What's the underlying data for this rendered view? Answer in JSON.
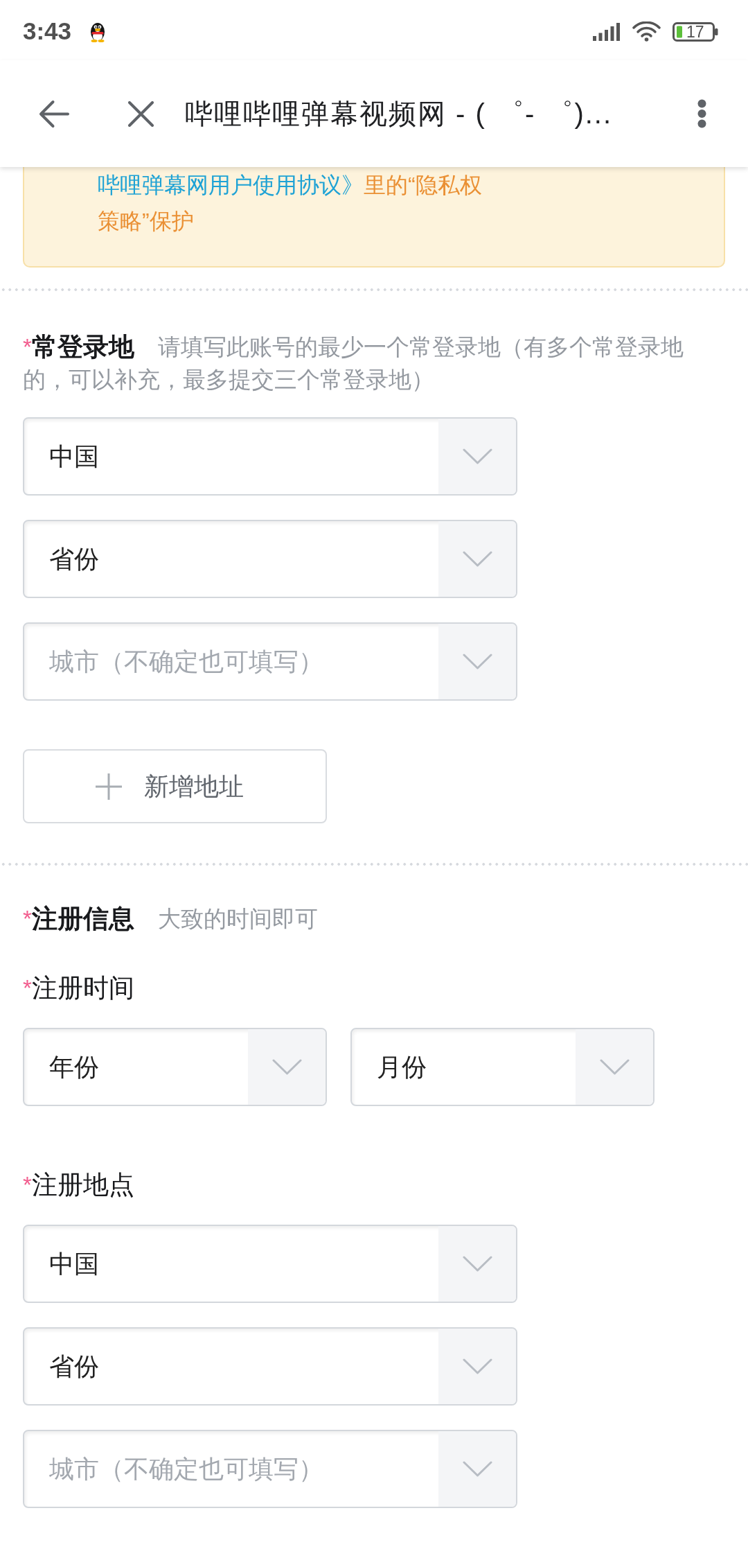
{
  "status_bar": {
    "time": "3:43",
    "battery": "17"
  },
  "toolbar": {
    "title": "哔哩哔哩弹幕视频网 - ( ゜- ゜)..."
  },
  "notice": {
    "link": "哔哩弹幕网用户使用协议》",
    "text": "里的“隐私权策略”保护"
  },
  "sections": [
    {
      "required_mark": "*",
      "title": "常登录地",
      "hint": "请填写此账号的最少一个常登录地（有多个常登录地的，可以补充，最多提交三个常登录地）",
      "fields": [
        {
          "kind": "stack",
          "selects": [
            {
              "value": "中国"
            },
            {
              "value": "省份"
            },
            {
              "placeholder": "城市（不确定也可填写）"
            }
          ]
        }
      ],
      "add_button": {
        "label": "新增地址"
      }
    },
    {
      "required_mark": "*",
      "title": "注册信息",
      "hint": "大致的时间即可",
      "fields": [
        {
          "kind": "row",
          "required_mark": "*",
          "label": "注册时间",
          "selects": [
            {
              "value": "年份"
            },
            {
              "value": "月份"
            }
          ]
        },
        {
          "kind": "stack",
          "required_mark": "*",
          "label": "注册地点",
          "selects": [
            {
              "value": "中国"
            },
            {
              "value": "省份"
            },
            {
              "placeholder": "城市（不确定也可填写）"
            }
          ]
        }
      ]
    }
  ]
}
